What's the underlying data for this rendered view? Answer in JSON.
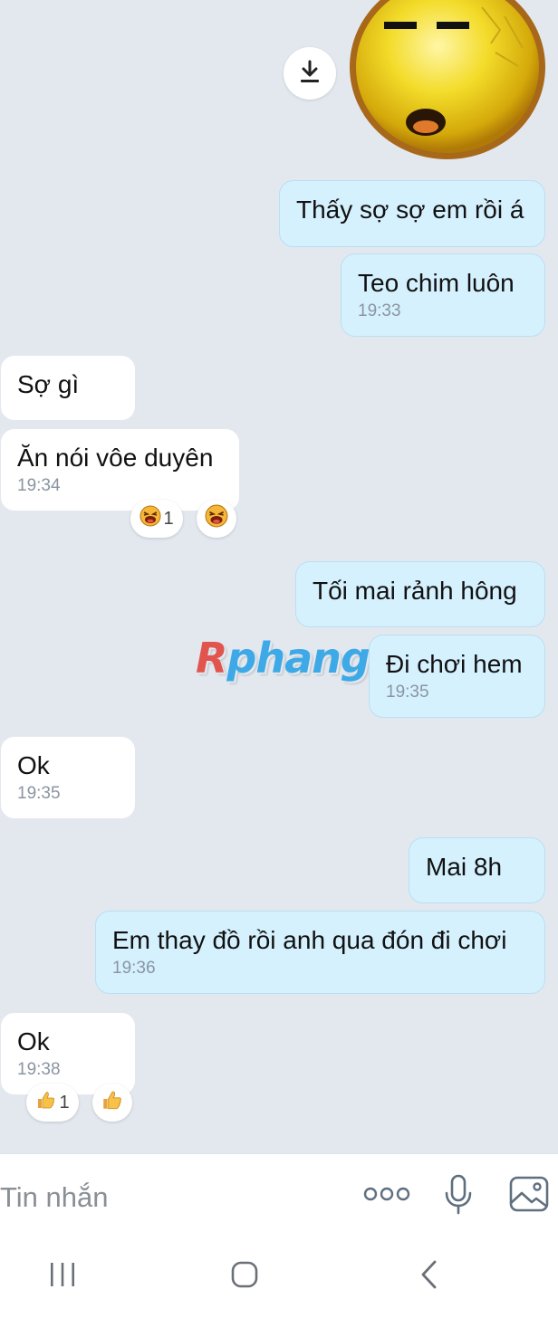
{
  "messages": [
    {
      "id": "m1",
      "side": "out",
      "text": "Thấy sợ sợ em rồi á",
      "time": ""
    },
    {
      "id": "m2",
      "side": "out",
      "text": "Teo chim luôn",
      "time": "19:33"
    },
    {
      "id": "m3",
      "side": "in",
      "text": "Sợ gì",
      "time": ""
    },
    {
      "id": "m4",
      "side": "in",
      "text": "Ăn nói vôe duyên",
      "time": "19:34"
    },
    {
      "id": "m5",
      "side": "out",
      "text": "Tối mai rảnh hông",
      "time": ""
    },
    {
      "id": "m6",
      "side": "out",
      "text": "Đi chơi hem",
      "time": "19:35"
    },
    {
      "id": "m7",
      "side": "in",
      "text": "Ok",
      "time": "19:35"
    },
    {
      "id": "m8",
      "side": "out",
      "text": "Mai 8h",
      "time": ""
    },
    {
      "id": "m9",
      "side": "out",
      "text": "Em thay đồ rồi anh qua đón đi chơi",
      "time": "19:36"
    },
    {
      "id": "m10",
      "side": "in",
      "text": "Ok",
      "time": "19:38"
    }
  ],
  "reactions": {
    "m4": {
      "icon": "laughing-emoji-icon",
      "count": "1"
    },
    "m10": {
      "icon": "thumbs-up-emoji-icon",
      "count": "1"
    }
  },
  "sticker": {
    "icon": "sleepy-face-sticker-icon"
  },
  "watermark": {
    "first": "R",
    "rest": "phang"
  },
  "input": {
    "placeholder": "Tin nhắn"
  },
  "colors": {
    "background": "#e3e8ef",
    "outgoing_bubble": "#d5f1fe",
    "incoming_bubble": "#ffffff",
    "timestamp": "#8a95a1",
    "icon": "#5f6f7f"
  }
}
